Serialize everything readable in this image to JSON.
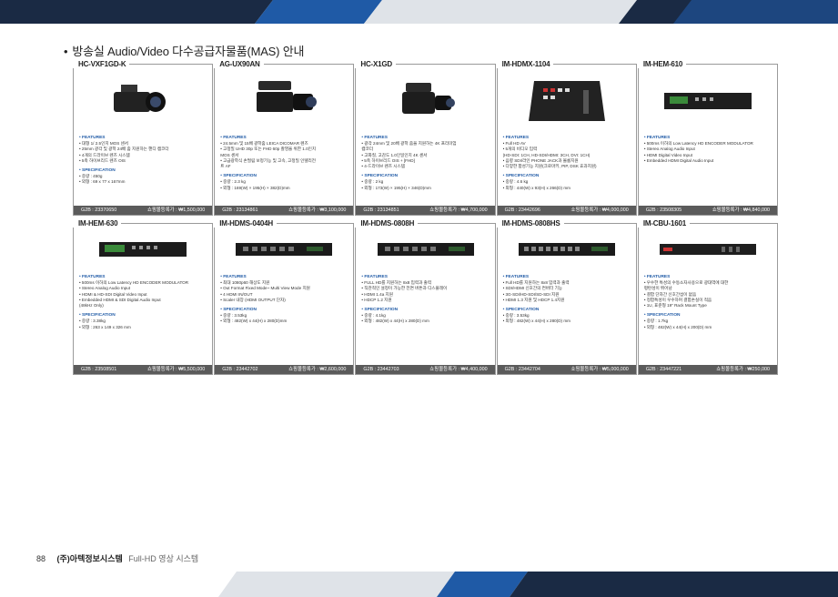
{
  "page_title": "방송실 Audio/Video 다수공급자물품(MAS) 안내",
  "title_bullet": "•",
  "footer": {
    "page_number": "88",
    "company": "(주)아텍정보시스템",
    "description": "Full-HD 영상 시스템"
  },
  "colors": {
    "accent_dark": "#1a2a44",
    "accent_blue": "#1f5aa6",
    "card_footer": "#5b5b5b"
  },
  "section_labels": {
    "features": "• FEATURES",
    "spec": "• SPECIFICATION"
  },
  "rows": [
    [
      {
        "model": "HC-VXF1GD-K",
        "icon": "camcorder-icon",
        "features": [
          "• 대형 1/ 2.5인치 MOS 센서",
          "• 25mm 광각 및 광학 24배 줌 지원하는 핸디 캠코더",
          "• 4개의 드라이브 렌즈 시스템",
          "• 5축 하이브리드 렌즈 OIS"
        ],
        "spec": [
          "• 중량 : 450g",
          "• 외형 : 69 x 77 x 167mm"
        ],
        "g2b": "G2B : 23370650",
        "price": "쇼핑몰등록가 : ₩1,500,000"
      },
      {
        "model": "AG-UX90AN",
        "icon": "pro-camcorder-icon",
        "features": [
          "• 24.5mm 및 15배 광학줌 LEICA DICOMAR 렌즈",
          "• 고정밀 UHD 30p 또는 FHD 60p 촬영을 위한 1.0인치",
          "  MOS 센서",
          "• 고급광학식 손떨림 보정기능 및 고속, 고정밀 인텔리전",
          "  트 AF"
        ],
        "spec": [
          "• 중량 : 2.3 kg",
          "• 외형 : 169(W) × 195(H) × 382(D)mm"
        ],
        "g2b": "G2B : 23134861",
        "price": "쇼핑몰등록가 : ₩3,100,000"
      },
      {
        "model": "HC-X1GD",
        "icon": "handheld-camcorder-icon",
        "features": [
          "• 광각 24mm 및 20배 광학 줌을 지원하는 4K 프리미엄",
          "  캠코더",
          "• 고화질, 고감도 1.0인일인치 4K 센서",
          "• 5축 하이브리드 OIS + [FHD]",
          "• 4-드라이브 렌즈 시스템"
        ],
        "spec": [
          "• 중량 : 2 kg",
          "• 외형 : 173(W) × 195(H) × 346(D)mm"
        ],
        "g2b": "G2B : 23134851",
        "price": "쇼핑몰등록가 : ₩4,700,000"
      },
      {
        "model": "IM-HDMX-1104",
        "icon": "video-switcher-icon",
        "features": [
          "• Full HD AV",
          "• 5개의 비디오 입력",
          "  (HD-SDI: 1CH, HD-SDI/HDMI: 3CH, DVI: 1CH)",
          "• 음향 SDI/라인 PHONE JACK과 볼륨지원",
          "• 다양한 합성기능 지원(크로마키, PIP, DSK 효과지원)"
        ],
        "spec": [
          "• 중량 : 4.6 kg",
          "• 외형 : 440(W) x 93(H) x 266(D) mm"
        ],
        "g2b": "G2B : 23442696",
        "price": "쇼핑몰등록가 : ₩4,000,000"
      },
      {
        "model": "IM-HEM-610",
        "icon": "encoder-icon",
        "features": [
          "• 500ms 이하의 Low Latency HD ENCODER MODULATOR",
          "• Stereo Analog Audio Input",
          "• HDMI Digital Video Input",
          "• Embedded HDMI Digital Audio Input"
        ],
        "spec": [],
        "g2b": "G2B : 23508305",
        "price": "쇼핑몰등록가 : ₩4,840,000"
      }
    ],
    [
      {
        "model": "IM-HEM-630",
        "icon": "encoder-rack-icon",
        "features": [
          "• 500ms 이하의 Low Latency HD ENCODER MODULATOR",
          "• Stereo Analog Audio Input",
          "• HDMI & HD-SDI Digital Video Input",
          "• Embedded HDMI & SDI Digital Audio Input",
          "  (48kHz Only)"
        ],
        "spec": [
          "• 중량 : 3.38kg",
          "• 외형 : 263 x 149 x 326 mm"
        ],
        "g2b": "G2B : 23508501",
        "price": "쇼핑몰등록가 : ₩5,500,000"
      },
      {
        "model": "IM-HDMS-0404H",
        "icon": "matrix-switcher-icon",
        "features": [
          "• 최대 1080p60 해상도 지원",
          "• Out Format Fixed Mode~ Multi View Mode 지원",
          "• 4 HDMI IN/OUT",
          "• Scaler 내장 (HDMI OUTPUT 단자)"
        ],
        "spec": [
          "• 중량 : 3.53kg",
          "• 외형 : 482(W) x 44(H) x 280(D)mm"
        ],
        "g2b": "G2B : 23442702",
        "price": "쇼핑몰등록가 : ₩2,600,000"
      },
      {
        "model": "IM-HDMS-0808H",
        "icon": "matrix-switcher-icon",
        "features": [
          "• FULL HD를 지원하는 8x8 입력과 출력",
          "• 직관적인 설정이 가능한 전면 버튼과 디스플레이",
          "• HDMI 1.4a 지원",
          "• HDCP 1.2 지원"
        ],
        "spec": [
          "• 중량 : 4.1kg",
          "• 외형 : 482(W) x 44(H) x 280(D) mm"
        ],
        "g2b": "G2B : 23442703",
        "price": "쇼핑몰등록가 : ₩4,400,000"
      },
      {
        "model": "IM-HDMS-0808HS",
        "icon": "sdi-matrix-icon",
        "features": [
          "• Full HD를 지원하는 8x8 입력과 출력",
          "• SDI/HDMI 신호간의 컨버터 기능",
          "• 3G-SDI/HD-SDI/SD-SDI 지원",
          "• HDMI 1.3 지원 및 HDCP 1.4지원"
        ],
        "spec": [
          "• 중량 : 3.53kg",
          "• 외형 : 482(W) x 44(H) x 280(D) mm"
        ],
        "g2b": "G2B : 23442704",
        "price": "쇼핑몰등록가 : ₩5,000,000"
      },
      {
        "model": "IM-CBU-1601",
        "icon": "rack-unit-icon",
        "features": [
          "• 우수한 특성의 수동소자사용으로 광대역에 대한",
          "  평탄성이 뛰어남",
          "• 결합 단자간 신호간섭이 없음",
          "• 정합특성이 우수하며 결합손실이 적음",
          "• 1U, 표준형 19\" Rack Mount Type"
        ],
        "spec": [
          "• 중량 : 1.7kg",
          "• 외형 : 482(W) x 44(H) x 200(D) mm"
        ],
        "g2b": "G2B : 23447221",
        "price": "쇼핑몰등록가 : ₩250,000"
      }
    ]
  ]
}
